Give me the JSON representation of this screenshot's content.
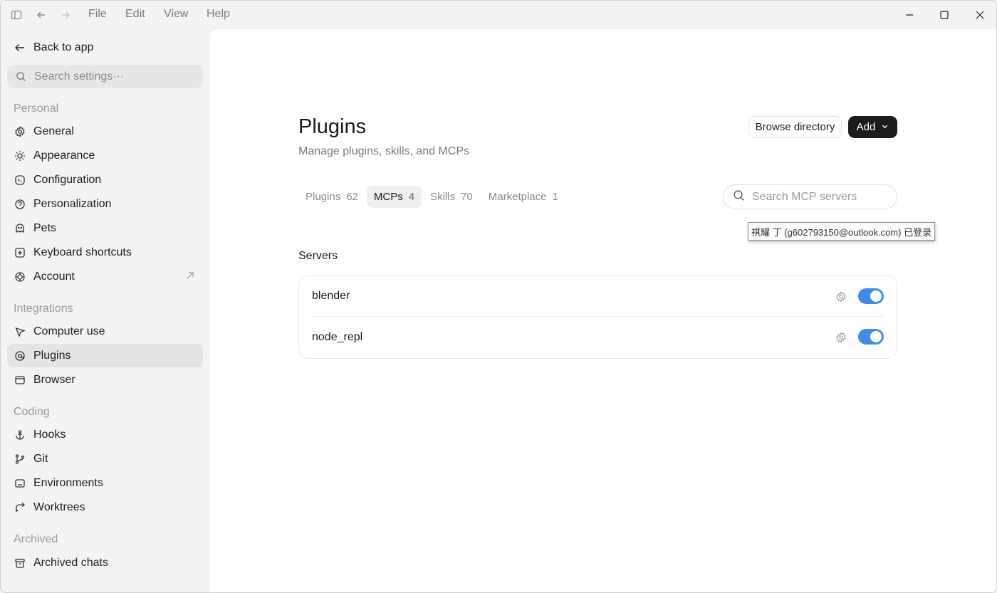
{
  "menu": {
    "file": "File",
    "edit": "Edit",
    "view": "View",
    "help": "Help"
  },
  "sidebar": {
    "back_label": "Back to app",
    "search_placeholder": "Search settings···",
    "sections": {
      "personal": "Personal",
      "integrations": "Integrations",
      "coding": "Coding",
      "archived": "Archived"
    },
    "items": {
      "general": "General",
      "appearance": "Appearance",
      "configuration": "Configuration",
      "personalization": "Personalization",
      "pets": "Pets",
      "keyboard_shortcuts": "Keyboard shortcuts",
      "account": "Account",
      "computer_use": "Computer use",
      "plugins": "Plugins",
      "browser": "Browser",
      "hooks": "Hooks",
      "git": "Git",
      "environments": "Environments",
      "worktrees": "Worktrees",
      "archived_chats": "Archived chats"
    }
  },
  "main": {
    "title": "Plugins",
    "subtitle": "Manage plugins, skills, and MCPs",
    "browse_label": "Browse directory",
    "add_label": "Add",
    "tabs": [
      {
        "label": "Plugins",
        "count": "62"
      },
      {
        "label": "MCPs",
        "count": "4"
      },
      {
        "label": "Skills",
        "count": "70"
      },
      {
        "label": "Marketplace",
        "count": "1"
      }
    ],
    "search_placeholder": "Search MCP servers",
    "tooltip": "祺耀 丁 (g602793150@outlook.com) 已登录",
    "servers_heading": "Servers",
    "servers": [
      {
        "name": "blender",
        "enabled": true
      },
      {
        "name": "node_repl",
        "enabled": true
      }
    ]
  },
  "colors": {
    "accent_toggle": "#3b8eea",
    "add_button": "#1c1c1c",
    "active_nav": "#e4e4e4"
  }
}
